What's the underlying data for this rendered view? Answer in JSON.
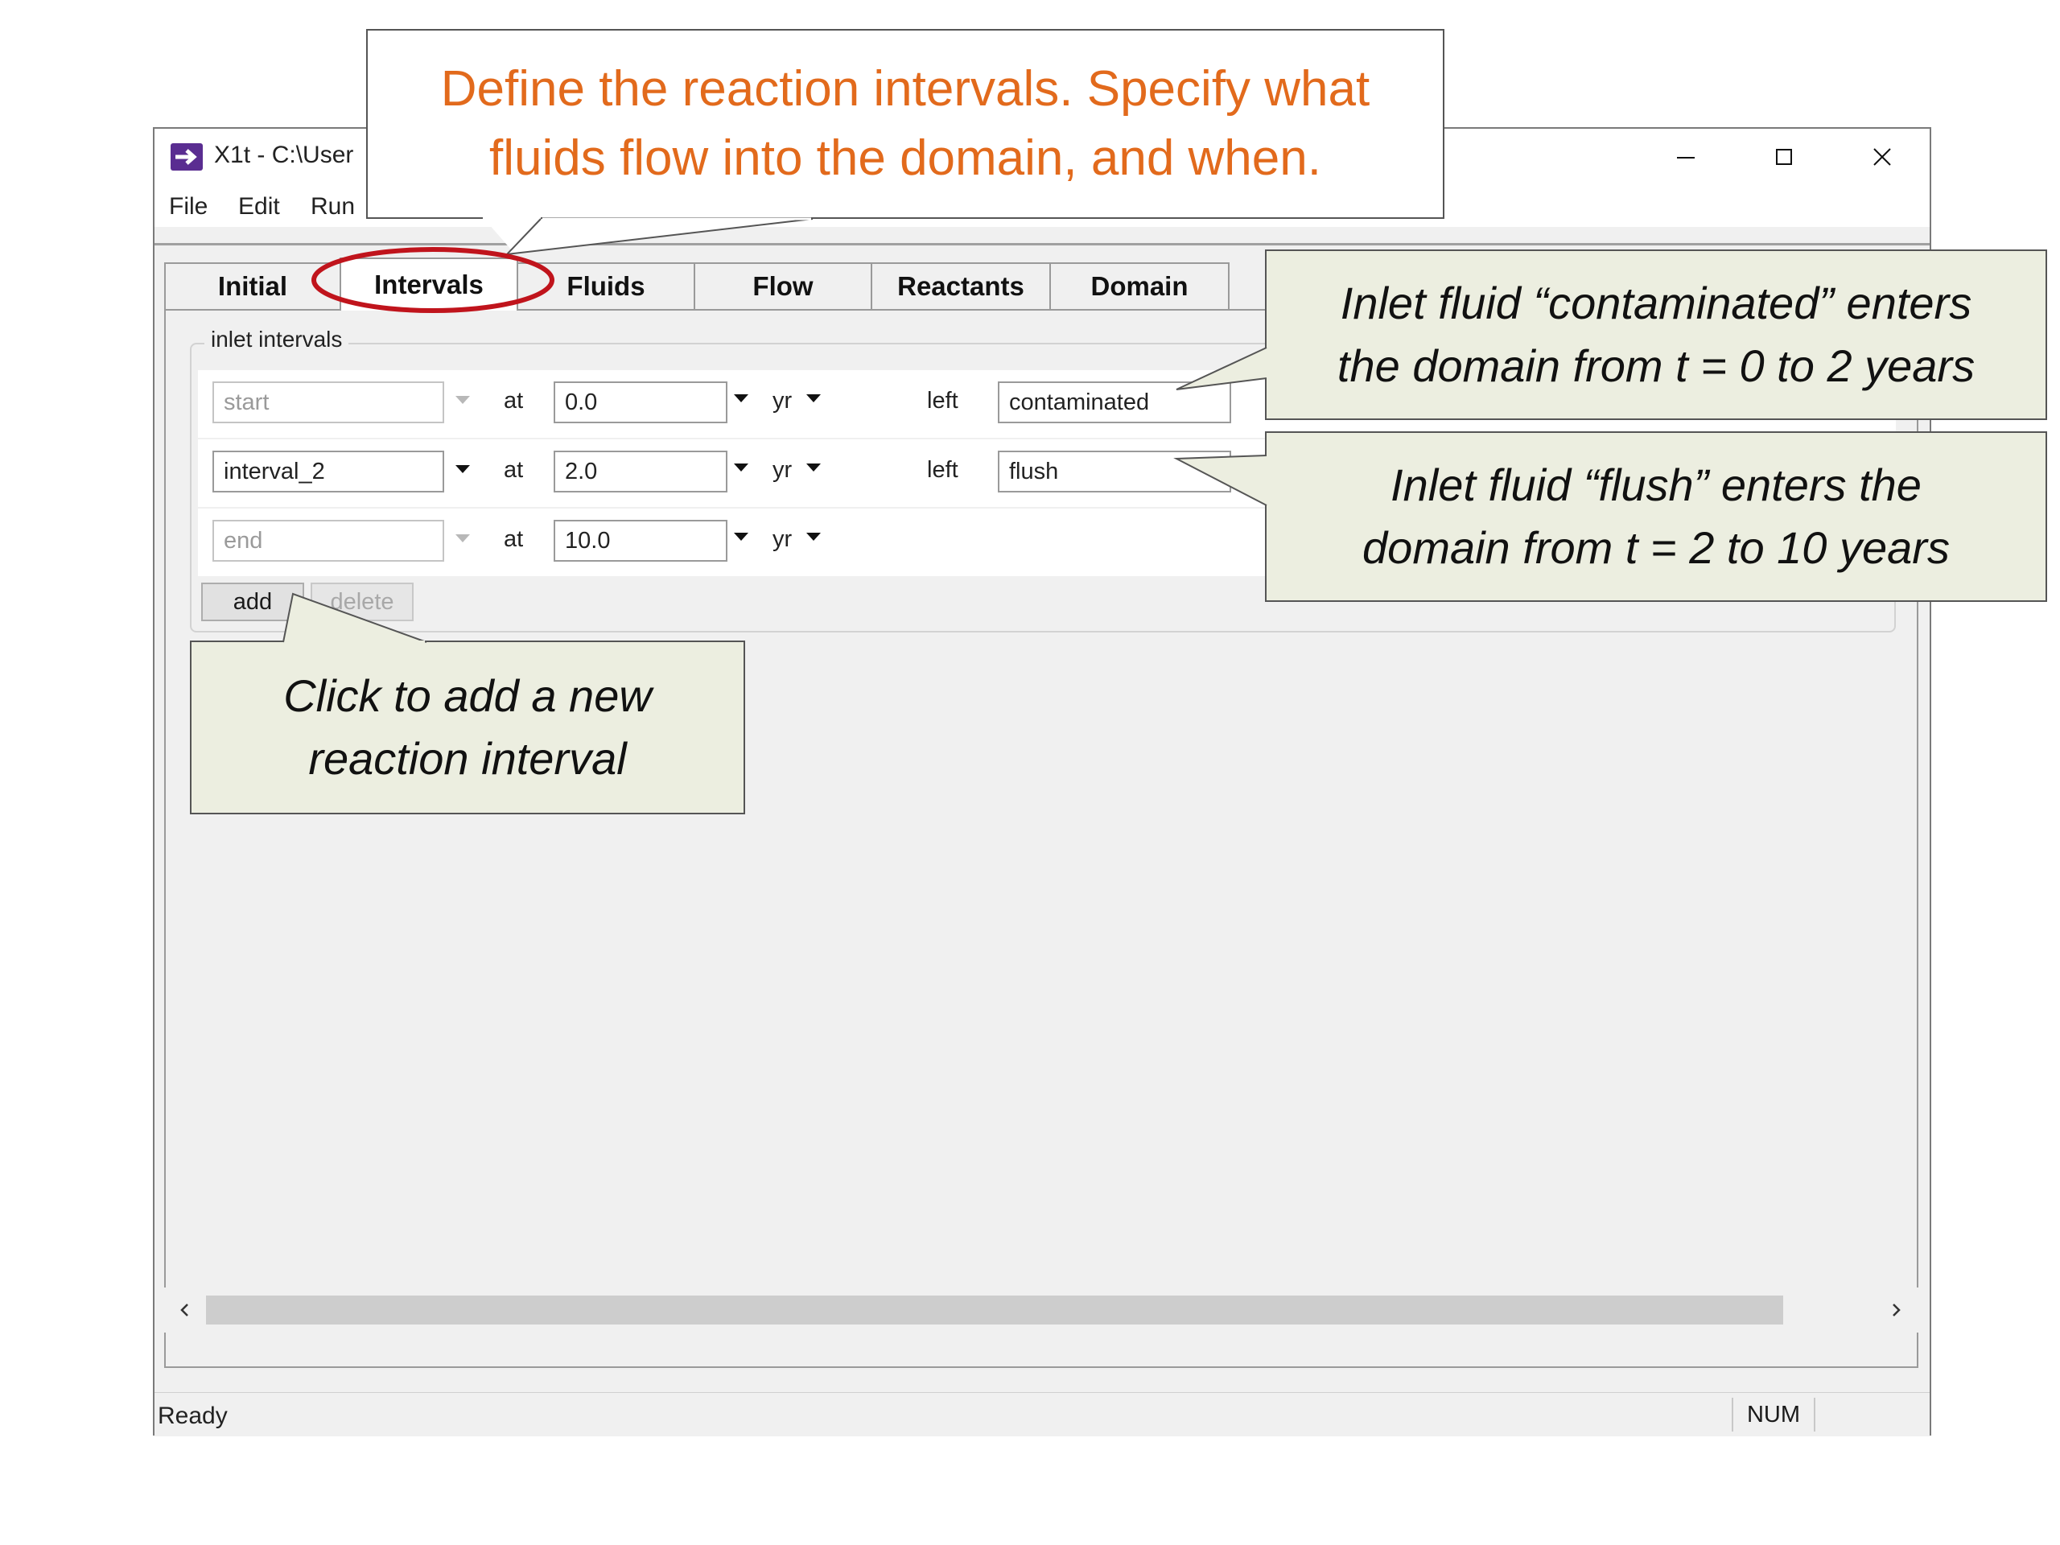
{
  "window": {
    "title": "X1t - C:\\User",
    "controls": {
      "minimize": "minimize-icon",
      "maximize": "maximize-icon",
      "close": "close-icon"
    }
  },
  "menu": [
    "File",
    "Edit",
    "Run"
  ],
  "tabs": [
    "Initial",
    "Intervals",
    "Fluids",
    "Flow",
    "Reactants",
    "Domain"
  ],
  "active_tab": "Intervals",
  "inlet_intervals": {
    "label": "inlet intervals",
    "rows": [
      {
        "name": "start",
        "at_label": "at",
        "time": "0.0",
        "unit": "yr",
        "side_label": "left",
        "fluid": "contaminated"
      },
      {
        "name": "interval_2",
        "at_label": "at",
        "time": "2.0",
        "unit": "yr",
        "side_label": "left",
        "fluid": "flush"
      },
      {
        "name": "end",
        "at_label": "at",
        "time": "10.0",
        "unit": "yr"
      }
    ],
    "add_label": "add",
    "delete_label": "delete"
  },
  "status": {
    "text": "Ready",
    "num": "NUM"
  },
  "callouts": {
    "top": [
      "Define the reaction intervals. Specify what",
      "fluids flow into the domain, and when."
    ],
    "contaminated": [
      "Inlet fluid “contaminated” enters",
      "the domain from t = 0 to 2 years"
    ],
    "flush": [
      "Inlet fluid “flush” enters the",
      "domain from t = 2 to 10 years"
    ],
    "add": [
      "Click to add a new",
      "reaction interval"
    ]
  },
  "colors": {
    "callout_text": "#e26a1c",
    "highlight_ellipse": "#c0141c",
    "callout_bg": "#eceee0"
  }
}
